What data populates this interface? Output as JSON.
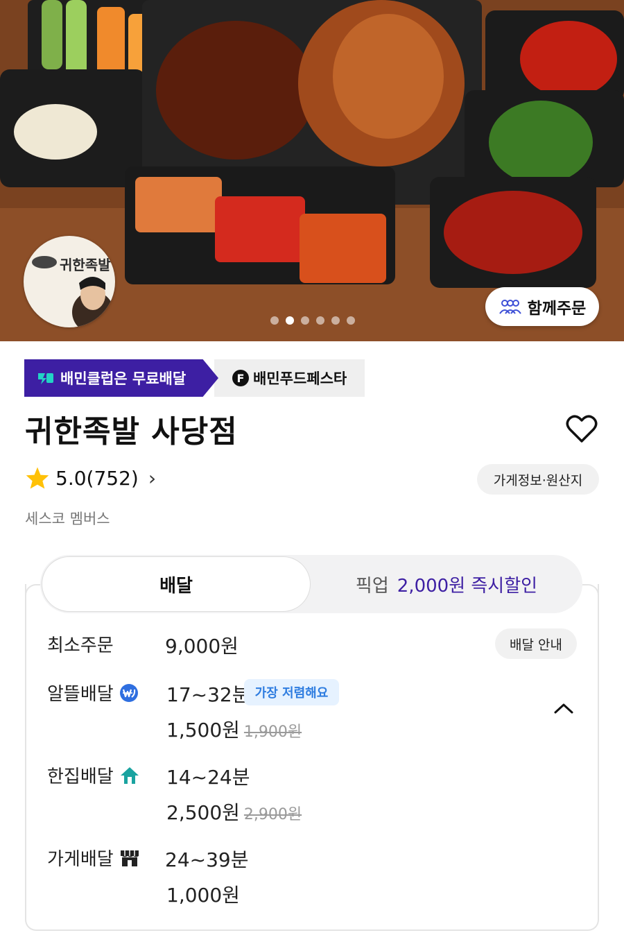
{
  "hero": {
    "brand_logo_text": "귀한족발",
    "together_order_label": "함께주문",
    "carousel_dots": 6,
    "carousel_active": 1
  },
  "badges": {
    "club_label": "배민클럽은 무료배달",
    "fest_icon": "F",
    "fest_label": "배민푸드페스타"
  },
  "store": {
    "name": "귀한족발 사당점",
    "rating_text": "5.0(752)",
    "rating_arrow": "›",
    "info_button": "가게정보·원산지",
    "member_text": "세스코 멤버스"
  },
  "tabs": {
    "delivery_label": "배달",
    "pickup_label": "픽업",
    "pickup_discount": "2,000원 즉시할인"
  },
  "delivery": {
    "min_order_label": "최소주문",
    "min_order_value": "9,000원",
    "guide_button": "배달 안내",
    "options": [
      {
        "label": "알뜰배달",
        "time": "17~32분",
        "badge": "가장 저렴해요",
        "price": "1,500원",
        "original_price": "1,900원"
      },
      {
        "label": "한집배달",
        "time": "14~24분",
        "price": "2,500원",
        "original_price": "2,900원"
      },
      {
        "label": "가게배달",
        "time": "24~39분",
        "price": "1,000원"
      }
    ]
  },
  "colors": {
    "club_purple": "#3d1fa3",
    "star_yellow": "#ffc107",
    "cheap_blue": "#2f7de0",
    "home_teal": "#1aa3a0"
  }
}
